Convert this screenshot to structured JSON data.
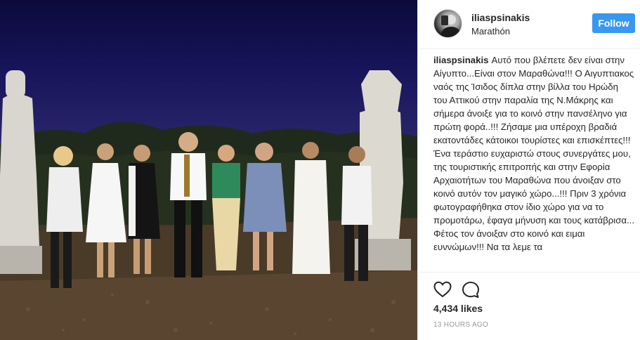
{
  "post": {
    "username": "iliaspsinakis",
    "location": "Marathón",
    "follow_label": "Follow",
    "caption_username": "iliaspsinakis",
    "caption_text": "Αυτό που βλέπετε δεν είναι στην Αίγυπτο...Είναι στον Μαραθώνα!!! Ο Αιγυπτιακος ναός της Ίσιδος δίπλα στην βίλλα του Ηρώδη του Αττικού στην παραλία της Ν.Μάκρης και σήμερα άνοιξε για το κοινό στην πανσέληνο για πρώτη φορά..!!! Ζήσαμε μια υπέροχη βραδιά εκατοντάδες κάτοικοι τουρίστες και επισκέπτες!!! Ένα τεράστιο ευχαριστώ στους συνεργάτες μου, της τουριστικής επιτροπής και στην Εφορία Αρχαιοτήτων του Μαραθώνα που άνοιξαν στο κοινό αυτόν τον μαγικό χώρο...!!! Πριν 3 χρόνια φωτογραφήθηκα στον ίδιο χώρο για να το προμοτάρω, έφαγα μήνυση και τους κατάβρισα... Φέτος τον άνοιξαν στο κοινό και ειμαι ευννώμων!!! Να τα λεμε τα",
    "likes": "4,434 likes",
    "timestamp": "13 HOURS AGO"
  },
  "icons": {
    "like": "heart-icon",
    "comment": "comment-bubble-icon"
  },
  "colors": {
    "follow_button": "#3897f0",
    "timestamp": "#999999",
    "text": "#262626"
  }
}
